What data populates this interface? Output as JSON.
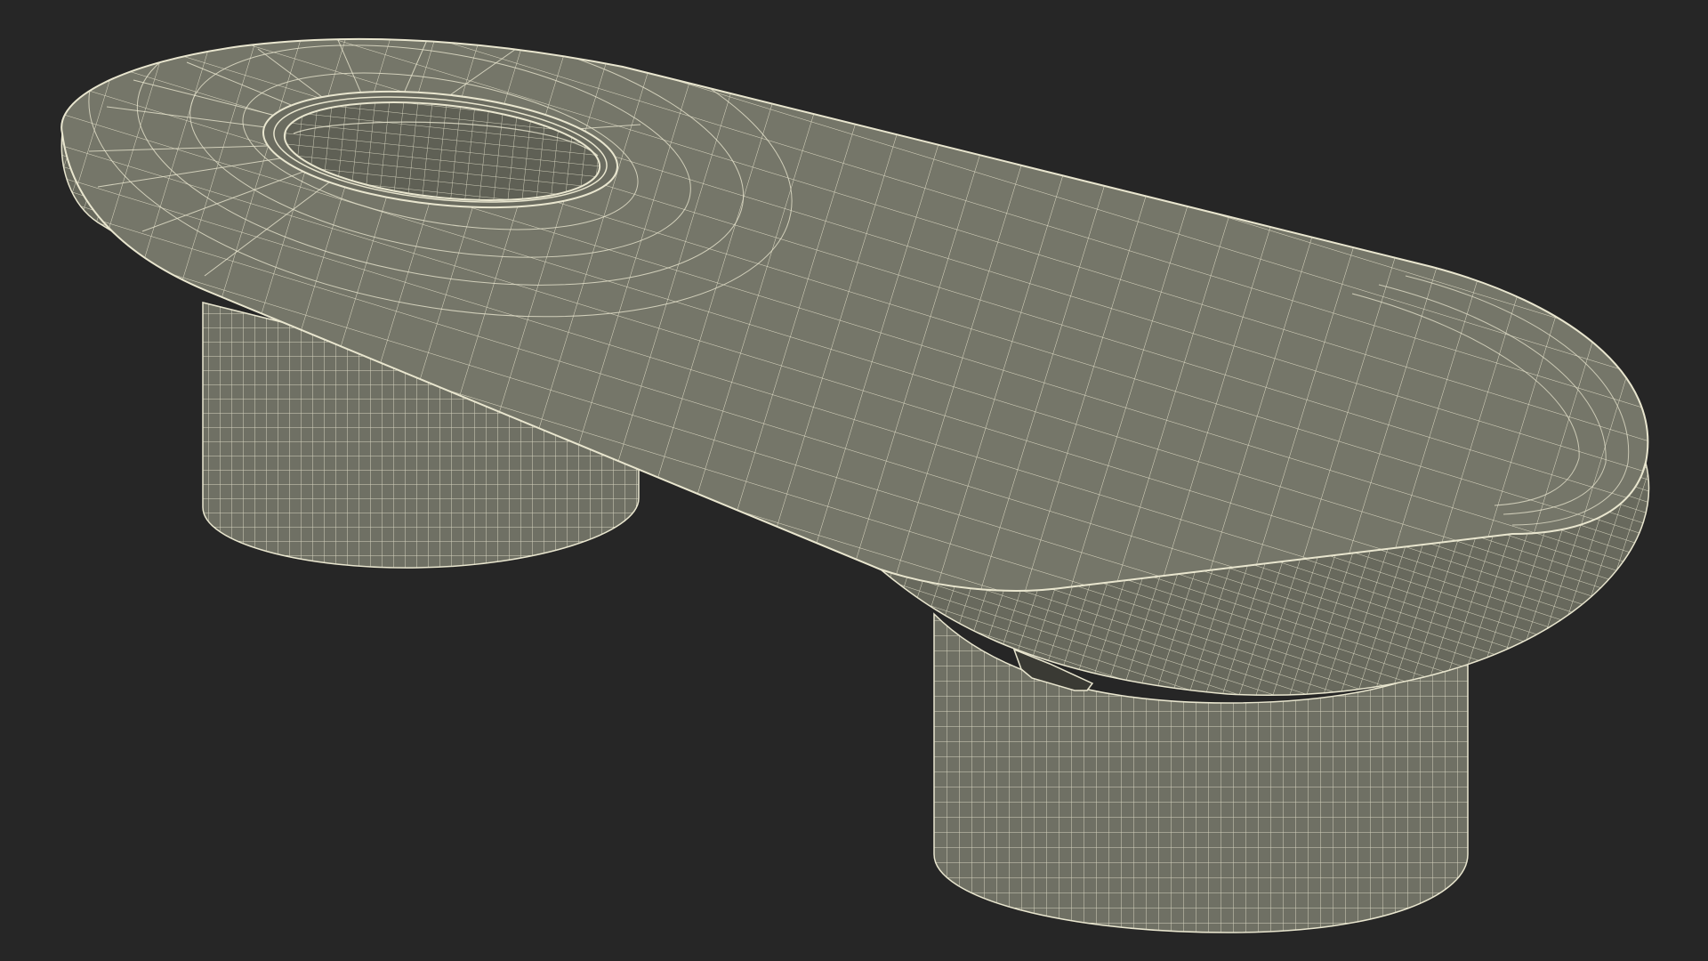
{
  "scene": {
    "subject": "wireframe-bench",
    "colors": {
      "background": "#262626",
      "surface": "#747568",
      "surface_shadow": "#656659",
      "surface_dark": "#5a5b50",
      "hole_inner": "#5e5f54",
      "wire": "#e9e6cf"
    }
  }
}
